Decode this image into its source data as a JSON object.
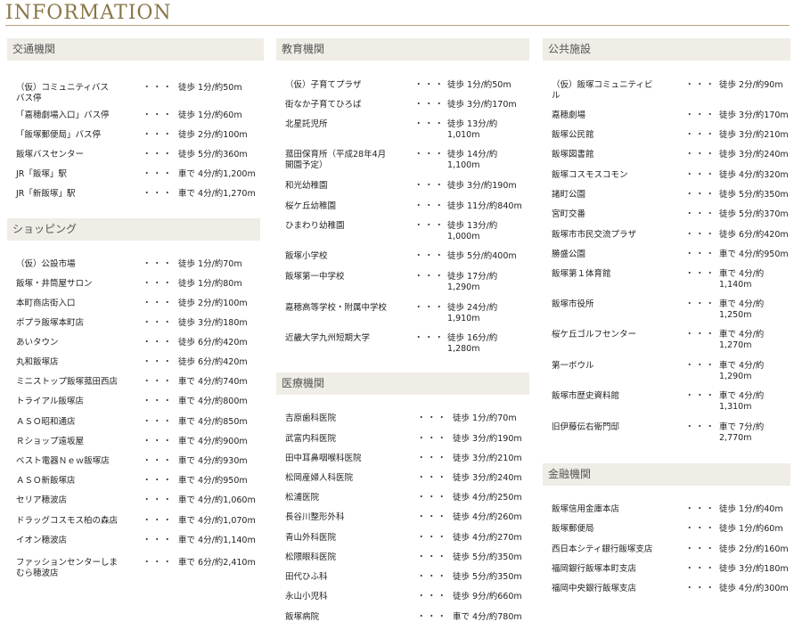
{
  "page_title": "INFORMATION",
  "sections": [
    {
      "title": "交通機関",
      "items": [
        {
          "name": "（仮）コミュニティバス\nバス停",
          "value": "徒歩 1分/約50m"
        },
        {
          "name": "「嘉穂劇場入口」バス停",
          "value": "徒歩 1分/約60m"
        },
        {
          "name": "「飯塚郵便局」バス停",
          "value": "徒歩 2分/約100m"
        },
        {
          "name": "飯塚バスセンター",
          "value": "徒歩 5分/約360m"
        },
        {
          "name": "JR「飯塚」駅",
          "value": "車で 4分/約1,200m"
        },
        {
          "name": "JR「新飯塚」駅",
          "value": "車で 4分/約1,270m"
        }
      ]
    },
    {
      "title": "ショッピング",
      "items": [
        {
          "name": "（仮）公設市場",
          "value": "徒歩 1分/約70m"
        },
        {
          "name": "飯塚・井筒屋サロン",
          "value": "徒歩 1分/約80m"
        },
        {
          "name": "本町商店街入口",
          "value": "徒歩 2分/約100m"
        },
        {
          "name": "ポプラ飯塚本町店",
          "value": "徒歩 3分/約180m"
        },
        {
          "name": "あいタウン",
          "value": "徒歩 6分/約420m"
        },
        {
          "name": "丸和飯塚店",
          "value": "徒歩 6分/約420m"
        },
        {
          "name": "ミニストップ飯塚菰田西店",
          "value": "車で 4分/約740m"
        },
        {
          "name": "トライアル飯塚店",
          "value": "車で 4分/約800m"
        },
        {
          "name": "ＡＳＯ昭和通店",
          "value": "車で 4分/約850m"
        },
        {
          "name": "Ｒショップ遠坂屋",
          "value": "車で 4分/約900m"
        },
        {
          "name": "ベスト電器Ｎｅｗ飯塚店",
          "value": "車で 4分/約930m"
        },
        {
          "name": "ＡＳＯ新飯塚店",
          "value": "車で 4分/約950m"
        },
        {
          "name": "セリア穂波店",
          "value": "車で 4分/約1,060m"
        },
        {
          "name": "ドラッグコスモス柏の森店",
          "value": "車で 4分/約1,070m"
        },
        {
          "name": "イオン穂波店",
          "value": "車で 4分/約1,140m"
        },
        {
          "name": "ファッションセンターしま\nむら穂波店",
          "value": "車で 6分/約2,410m"
        }
      ]
    },
    {
      "title": "教育機関",
      "items": [
        {
          "name": "（仮）子育てプラザ",
          "value": "徒歩 1分/約50m"
        },
        {
          "name": "街なか子育てひろば",
          "value": "徒歩 3分/約170m"
        },
        {
          "name": "北星託児所",
          "value": "徒歩 13分/約\n1,010m"
        },
        {
          "name": "菰田保育所（平成28年4月\n開園予定）",
          "value": "徒歩 14分/約\n1,100m"
        },
        {
          "name": "和光幼稚園",
          "value": "徒歩 3分/約190m"
        },
        {
          "name": "桜ケ丘幼稚園",
          "value": "徒歩 11分/約840m"
        },
        {
          "name": "ひまわり幼稚園",
          "value": "徒歩 13分/約\n1,000m"
        },
        {
          "name": "飯塚小学校",
          "value": "徒歩 5分/約400m"
        },
        {
          "name": "飯塚第一中学校",
          "value": "徒歩 17分/約\n1,290m"
        },
        {
          "name": "嘉穂高等学校・附属中学校",
          "value": "徒歩 24分/約\n1,910m"
        },
        {
          "name": "近畿大学九州短期大学",
          "value": "徒歩 16分/約\n1,280m"
        }
      ]
    },
    {
      "title": "医療機関",
      "items": [
        {
          "name": "吉原歯科医院",
          "value": "徒歩 1分/約70m"
        },
        {
          "name": "武富内科医院",
          "value": "徒歩 3分/約190m"
        },
        {
          "name": "田中耳鼻咽喉科医院",
          "value": "徒歩 3分/約210m"
        },
        {
          "name": "松岡産婦人科医院",
          "value": "徒歩 3分/約240m"
        },
        {
          "name": "松浦医院",
          "value": "徒歩 4分/約250m"
        },
        {
          "name": "長谷川整形外科",
          "value": "徒歩 4分/約260m"
        },
        {
          "name": "青山外科医院",
          "value": "徒歩 4分/約270m"
        },
        {
          "name": "松隈眼科医院",
          "value": "徒歩 5分/約350m"
        },
        {
          "name": "田代ひふ科",
          "value": "徒歩 5分/約350m"
        },
        {
          "name": "永山小児科",
          "value": "徒歩 9分/約660m"
        },
        {
          "name": "飯塚病院",
          "value": "車で 4分/約780m"
        }
      ]
    },
    {
      "title": "公共施設",
      "items": [
        {
          "name": "（仮）飯塚コミュニティビ\nル",
          "value": "徒歩 2分/約90m"
        },
        {
          "name": "嘉穂劇場",
          "value": "徒歩 3分/約170m"
        },
        {
          "name": "飯塚公民館",
          "value": "徒歩 3分/約210m"
        },
        {
          "name": "飯塚図書館",
          "value": "徒歩 3分/約240m"
        },
        {
          "name": "飯塚コスモスコモン",
          "value": "徒歩 4分/約320m"
        },
        {
          "name": "諸町公園",
          "value": "徒歩 5分/約350m"
        },
        {
          "name": "宮町交番",
          "value": "徒歩 5分/約370m"
        },
        {
          "name": "飯塚市市民交流プラザ",
          "value": "徒歩 6分/約420m"
        },
        {
          "name": "勝盛公園",
          "value": "車で 4分/約950m"
        },
        {
          "name": "飯塚第１体育館",
          "value": "車で 4分/約\n1,140m"
        },
        {
          "name": "飯塚市役所",
          "value": "車で 4分/約\n1,250m"
        },
        {
          "name": "桜ケ丘ゴルフセンター",
          "value": "車で 4分/約\n1,270m"
        },
        {
          "name": "第一ボウル",
          "value": "車で 4分/約\n1,290m"
        },
        {
          "name": "飯塚市歴史資料館",
          "value": "車で 4分/約\n1,310m"
        },
        {
          "name": "旧伊藤伝右衛門邸",
          "value": "車で 7分/約\n2,770m"
        }
      ]
    },
    {
      "title": "金融機関",
      "items": [
        {
          "name": "飯塚信用金庫本店",
          "value": "徒歩 1分/約40m"
        },
        {
          "name": "飯塚郵便局",
          "value": "徒歩 1分/約60m"
        },
        {
          "name": "西日本シティ銀行飯塚支店",
          "value": "徒歩 2分/約160m"
        },
        {
          "name": "福岡銀行飯塚本町支店",
          "value": "徒歩 3分/約180m"
        },
        {
          "name": "福岡中央銀行飯塚支店",
          "value": "徒歩 4分/約300m"
        }
      ]
    }
  ],
  "separator": "・・・"
}
